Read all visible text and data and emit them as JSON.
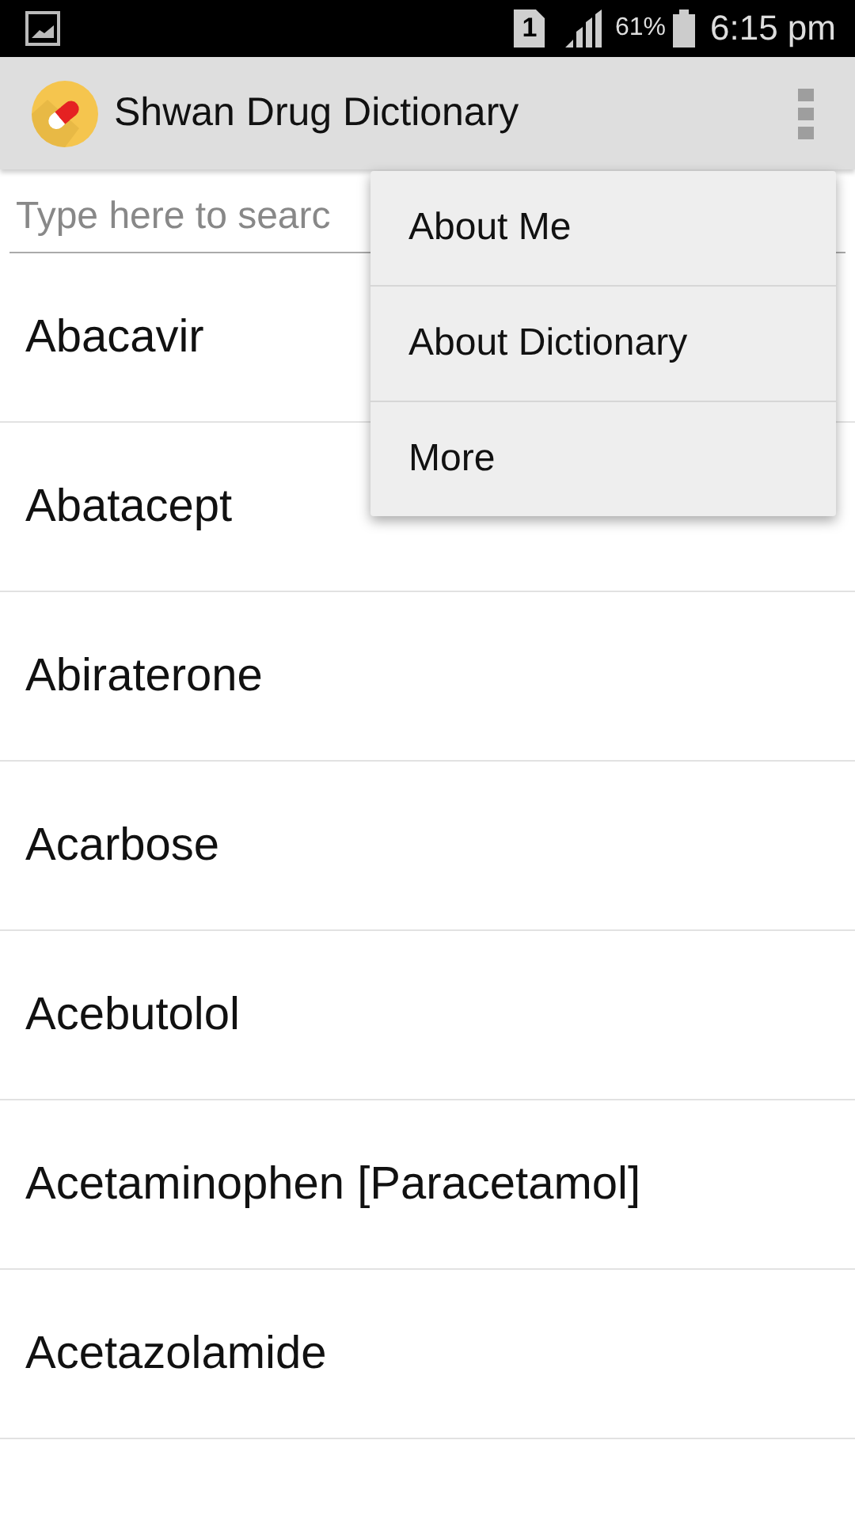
{
  "status_bar": {
    "sim_slot": "1",
    "battery_percent": "61%",
    "time": "6:15 pm"
  },
  "app_bar": {
    "title": "Shwan Drug Dictionary"
  },
  "search": {
    "placeholder": "Type here to searc"
  },
  "drugs": [
    {
      "name": "Abacavir"
    },
    {
      "name": "Abatacept"
    },
    {
      "name": "Abiraterone"
    },
    {
      "name": "Acarbose"
    },
    {
      "name": "Acebutolol"
    },
    {
      "name": "Acetaminophen [Paracetamol]"
    },
    {
      "name": "Acetazolamide"
    }
  ],
  "overflow_menu": {
    "items": [
      {
        "label": "About Me"
      },
      {
        "label": "About Dictionary"
      },
      {
        "label": "More"
      }
    ]
  }
}
